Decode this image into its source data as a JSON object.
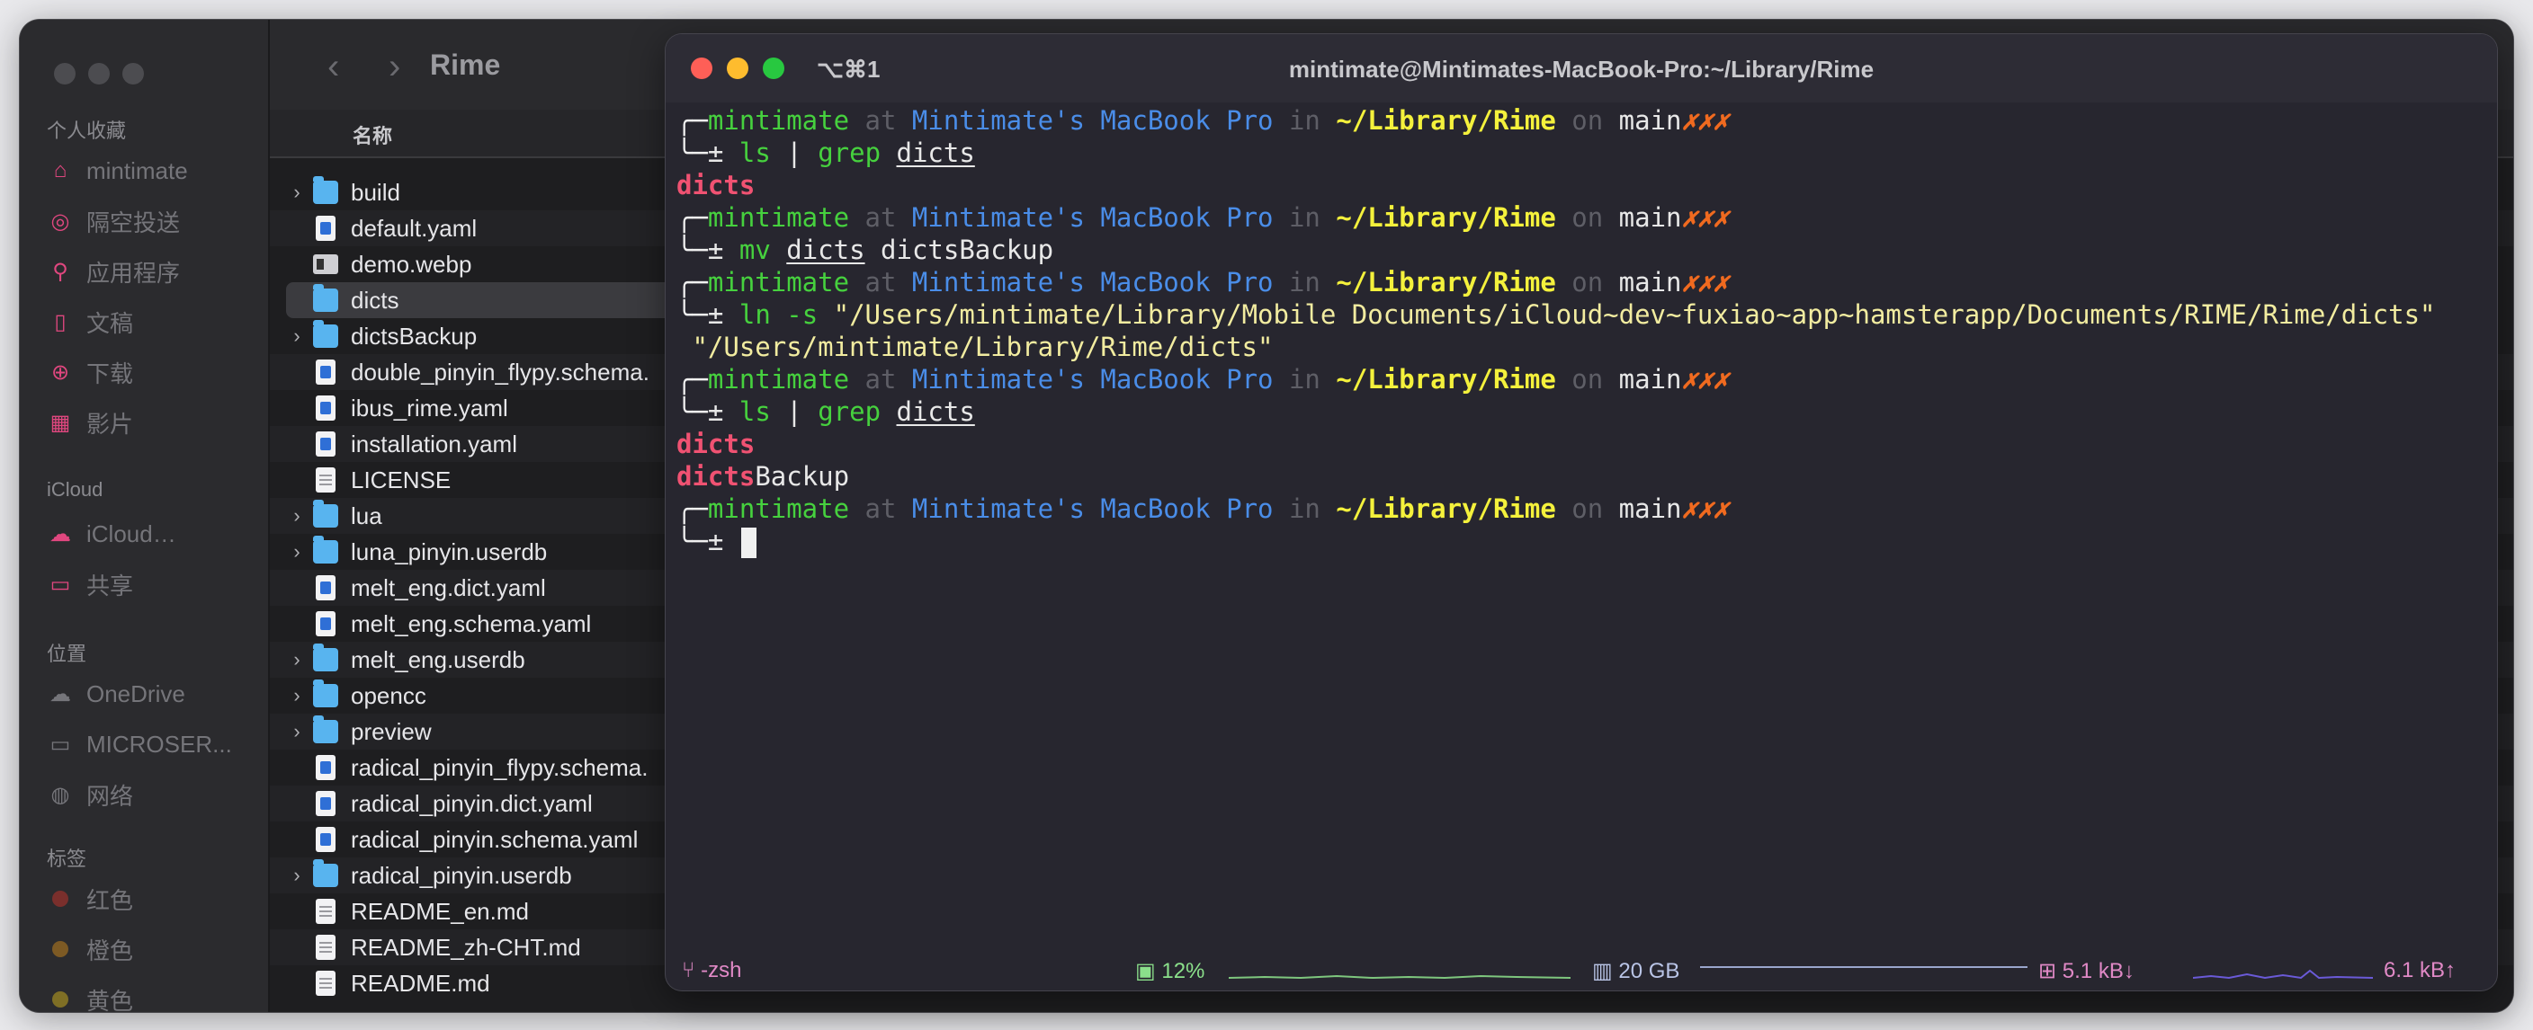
{
  "finder": {
    "title": "Rime",
    "column_name": "名称",
    "sidebar": {
      "sections": [
        "个人收藏",
        "iCloud",
        "位置",
        "标签"
      ],
      "favorites": [
        {
          "label": "mintimate",
          "icon": "house-icon"
        },
        {
          "label": "隔空投送",
          "icon": "airdrop-icon"
        },
        {
          "label": "应用程序",
          "icon": "apps-icon"
        },
        {
          "label": "文稿",
          "icon": "document-icon"
        },
        {
          "label": "下载",
          "icon": "download-icon"
        },
        {
          "label": "影片",
          "icon": "film-icon"
        }
      ],
      "icloud": [
        {
          "label": "iCloud…",
          "icon": "cloud-icon"
        },
        {
          "label": "共享",
          "icon": "shared-folder-icon"
        }
      ],
      "locations": [
        {
          "label": "OneDrive",
          "icon": "cloud-icon"
        },
        {
          "label": "MICROSER...",
          "icon": "display-icon"
        },
        {
          "label": "网络",
          "icon": "globe-icon"
        }
      ],
      "tags": [
        {
          "label": "红色",
          "color": "#d8443c"
        },
        {
          "label": "橙色",
          "color": "#e2952b"
        },
        {
          "label": "黄色",
          "color": "#e8c62c"
        }
      ]
    },
    "files": [
      {
        "name": "build",
        "kind": "folder",
        "expandable": true
      },
      {
        "name": "default.yaml",
        "kind": "yaml",
        "expandable": false
      },
      {
        "name": "demo.webp",
        "kind": "image",
        "expandable": false
      },
      {
        "name": "dicts",
        "kind": "folder",
        "expandable": false
      },
      {
        "name": "dictsBackup",
        "kind": "folder",
        "expandable": true
      },
      {
        "name": "double_pinyin_flypy.schema.",
        "kind": "yaml",
        "expandable": false
      },
      {
        "name": "ibus_rime.yaml",
        "kind": "yaml",
        "expandable": false
      },
      {
        "name": "installation.yaml",
        "kind": "yaml",
        "expandable": false
      },
      {
        "name": "LICENSE",
        "kind": "plain",
        "expandable": false
      },
      {
        "name": "lua",
        "kind": "folder",
        "expandable": true
      },
      {
        "name": "luna_pinyin.userdb",
        "kind": "folder",
        "expandable": true
      },
      {
        "name": "melt_eng.dict.yaml",
        "kind": "yaml",
        "expandable": false
      },
      {
        "name": "melt_eng.schema.yaml",
        "kind": "yaml",
        "expandable": false
      },
      {
        "name": "melt_eng.userdb",
        "kind": "folder",
        "expandable": true
      },
      {
        "name": "opencc",
        "kind": "folder",
        "expandable": true
      },
      {
        "name": "preview",
        "kind": "folder",
        "expandable": true
      },
      {
        "name": "radical_pinyin_flypy.schema.",
        "kind": "yaml",
        "expandable": false
      },
      {
        "name": "radical_pinyin.dict.yaml",
        "kind": "yaml",
        "expandable": false
      },
      {
        "name": "radical_pinyin.schema.yaml",
        "kind": "yaml",
        "expandable": false
      },
      {
        "name": "radical_pinyin.userdb",
        "kind": "folder",
        "expandable": true
      },
      {
        "name": "README_en.md",
        "kind": "plain",
        "expandable": false
      },
      {
        "name": "README_zh-CHT.md",
        "kind": "plain",
        "expandable": false
      },
      {
        "name": "README.md",
        "kind": "plain",
        "expandable": false
      }
    ],
    "selected_file": "dicts"
  },
  "terminal": {
    "shortcut": "⌥⌘1",
    "title": "mintimate@Mintimates-MacBook-Pro:~/Library/Rime",
    "prompt": {
      "user": "mintimate",
      "at": "at",
      "host": "Mintimate's MacBook Pro",
      "in": "in",
      "path": "~/Library/Rime",
      "on": "on",
      "branch": "main",
      "status": "✗✗✗",
      "symbol": "±"
    },
    "cmd1": {
      "a": "ls",
      "b": "|",
      "c": "grep",
      "d": "dicts"
    },
    "out1": "dicts",
    "cmd2": {
      "a": "mv",
      "b": "dicts",
      "c": "dictsBackup"
    },
    "cmd3": {
      "a": "ln",
      "b": "-s",
      "src": "\"/Users/mintimate/Library/Mobile Documents/iCloud~dev~fuxiao~app~hamsterapp/Documents/RIME/Rime/dicts\"",
      "dst": " \"/Users/mintimate/Library/Rime/dicts\""
    },
    "cmd4": {
      "a": "ls",
      "b": "|",
      "c": "grep",
      "d": "dicts"
    },
    "out4a": "dicts",
    "out4b_match": "dicts",
    "out4b_rest": "Backup",
    "status_bar": {
      "shell": "-zsh",
      "cpu": "12%",
      "memory": "20 GB",
      "net_down": "5.1 kB↓",
      "net_up": "6.1 kB↑"
    }
  }
}
